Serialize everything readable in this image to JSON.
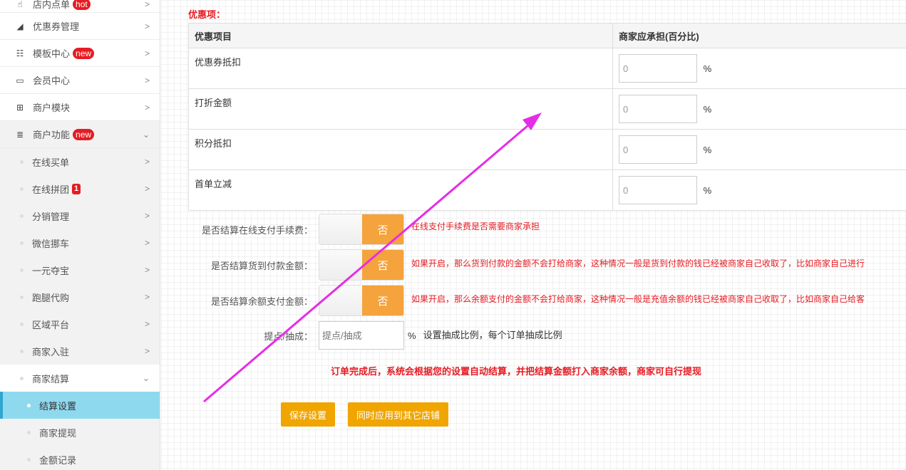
{
  "sidebar": {
    "items": [
      {
        "label": "店内点单",
        "badge": "hot",
        "arrow": ">"
      },
      {
        "label": "优惠券管理",
        "arrow": ">"
      },
      {
        "label": "模板中心",
        "badge": "new",
        "arrow": ">"
      },
      {
        "label": "会员中心",
        "arrow": ">"
      },
      {
        "label": "商户模块",
        "arrow": ">"
      },
      {
        "label": "商户功能",
        "badge": "new",
        "arrow": "⌄"
      }
    ],
    "sub_items": [
      {
        "label": "在线买单",
        "arrow": ">"
      },
      {
        "label": "在线拼团",
        "badge": "1",
        "arrow": ">"
      },
      {
        "label": "分销管理",
        "arrow": ">"
      },
      {
        "label": "微信挪车",
        "arrow": ">"
      },
      {
        "label": "一元夺宝",
        "arrow": ">"
      },
      {
        "label": "跑腿代购",
        "arrow": ">"
      },
      {
        "label": "区域平台",
        "arrow": ">"
      },
      {
        "label": "商家入驻",
        "arrow": ">"
      },
      {
        "label": "商家结算",
        "arrow": "⌄"
      }
    ],
    "settle_items": [
      {
        "label": "结算设置"
      },
      {
        "label": "商家提现"
      },
      {
        "label": "金额记录"
      }
    ]
  },
  "main": {
    "section_title": "优惠项：",
    "table": {
      "headers": [
        "优惠项目",
        "商家应承担(百分比)"
      ],
      "rows": [
        {
          "name": "优惠券抵扣",
          "value": "0",
          "unit": "%"
        },
        {
          "name": "打折金额",
          "value": "0",
          "unit": "%"
        },
        {
          "name": "积分抵扣",
          "value": "0",
          "unit": "%"
        },
        {
          "name": "首单立减",
          "value": "0",
          "unit": "%"
        }
      ]
    },
    "fields": [
      {
        "label": "是否结算在线支付手续费：",
        "toggle": "否",
        "hint": "在线支付手续费是否需要商家承担"
      },
      {
        "label": "是否结算货到付款金额：",
        "toggle": "否",
        "hint": "如果开启，那么货到付款的金额不会打给商家，这种情况一般是货到付款的钱已经被商家自己收取了，比如商家自己进行"
      },
      {
        "label": "是否结算余额支付金额：",
        "toggle": "否",
        "hint": "如果开启，那么余额支付的金额不会打给商家，这种情况一般是充值余额的钱已经被商家自己收取了，比如商家自己给客"
      }
    ],
    "commission": {
      "label": "提点/抽成：",
      "placeholder": "提点/抽成",
      "unit": "%",
      "note": "设置抽成比例，每个订单抽成比例"
    },
    "notice": "订单完成后，系统会根据您的设置自动结算，并把结算金额打入商家余额，商家可自行提现",
    "buttons": {
      "save": "保存设置",
      "apply_all": "同时应用到其它店铺"
    }
  },
  "colors": {
    "accent": "#f0a500",
    "danger": "#e51c23",
    "active": "#8fd9ef",
    "annotation": "#e62de6"
  }
}
